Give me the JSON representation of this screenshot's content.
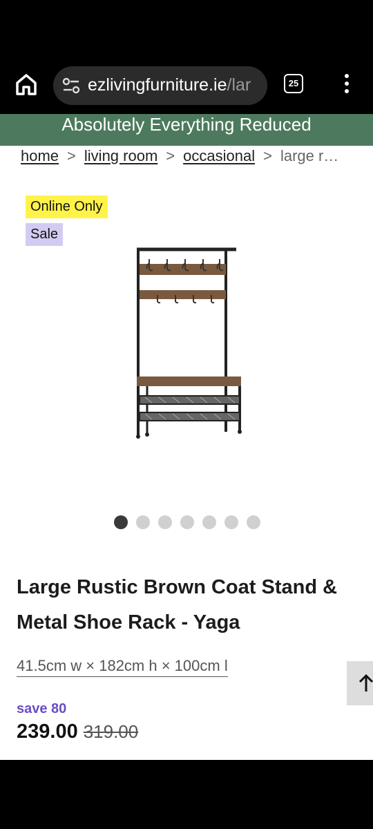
{
  "browser": {
    "url_main": "ezlivingfurniture.ie",
    "url_rest": "/lar",
    "tab_count": "25"
  },
  "promo": {
    "text": "Absolutely Everything Reduced",
    "bg_color": "#4d7a5e"
  },
  "breadcrumb": {
    "items": [
      "home",
      "living room",
      "occasional"
    ],
    "current": "large r…",
    "separator": ">"
  },
  "badges": {
    "online_only": "Online Only",
    "sale": "Sale",
    "online_color": "#fff34a",
    "sale_color": "#d4cbf2"
  },
  "gallery": {
    "total": 7,
    "active": 1
  },
  "product": {
    "title": "Large Rustic Brown Coat Stand & Metal Shoe Rack - Yaga",
    "dimensions": "41.5cm w × 182cm h × 100cm l",
    "save": "save 80",
    "price": "239.00",
    "was_price": "319.00",
    "accent_color": "#6a4cc4"
  },
  "icons": {
    "home": "home-icon",
    "site_info": "site-settings-icon",
    "menu": "more-vert-icon",
    "scroll_top": "arrow-up-icon"
  }
}
